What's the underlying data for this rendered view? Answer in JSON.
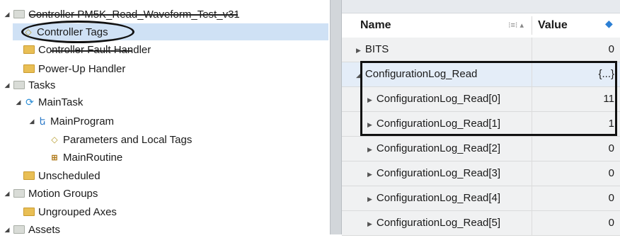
{
  "tree": {
    "controller": "Controller PM5K_Read_Waveform_Test_v31",
    "controller_tags": "Controller Tags",
    "fault_handler": "Controller Fault Handler",
    "powerup_handler": "Power-Up Handler",
    "tasks": "Tasks",
    "main_task": "MainTask",
    "main_program": "MainProgram",
    "params_tags": "Parameters and Local Tags",
    "main_routine": "MainRoutine",
    "unscheduled": "Unscheduled",
    "motion_groups": "Motion Groups",
    "ungrouped_axes": "Ungrouped Axes",
    "assets": "Assets"
  },
  "grid": {
    "header_name": "Name",
    "header_value": "Value",
    "rows": [
      {
        "name": "BITS",
        "value": "0"
      },
      {
        "name": "ConfigurationLog_Read",
        "value": "{...}"
      },
      {
        "name": "ConfigurationLog_Read[0]",
        "value": "11"
      },
      {
        "name": "ConfigurationLog_Read[1]",
        "value": "1"
      },
      {
        "name": "ConfigurationLog_Read[2]",
        "value": "0"
      },
      {
        "name": "ConfigurationLog_Read[3]",
        "value": "0"
      },
      {
        "name": "ConfigurationLog_Read[4]",
        "value": "0"
      },
      {
        "name": "ConfigurationLog_Read[5]",
        "value": "0"
      }
    ]
  },
  "colors": {
    "selection": "#cfe1f5",
    "folder": "#e9bf55",
    "highlight_row": "#e4edf8",
    "annotation": "#111111"
  }
}
